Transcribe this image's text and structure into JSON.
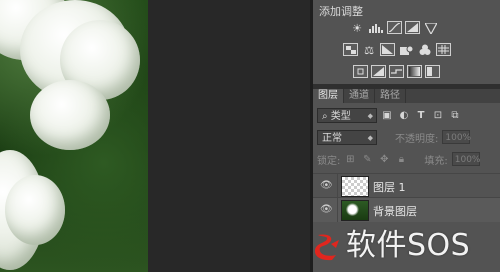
{
  "adjustments": {
    "title": "添加调整",
    "row1_icons": [
      "brightness-sun-icon",
      "levels-icon",
      "curves-icon",
      "exposure-icon",
      "vibrance-triangle-icon"
    ],
    "row2_icons": [
      "hue-saturation-icon",
      "color-balance-icon",
      "black-white-icon",
      "photo-filter-icon",
      "channel-mixer-icon",
      "color-lookup-icon"
    ],
    "row3_icons": [
      "invert-icon",
      "posterize-icon",
      "threshold-icon",
      "gradient-map-icon",
      "selective-color-icon"
    ]
  },
  "layers_panel": {
    "tabs": [
      "图层",
      "通道",
      "路径"
    ],
    "active_tab": 0,
    "filter": {
      "search_glyph": "⌕",
      "kind_label": "类型"
    },
    "blend_mode": "正常",
    "opacity_label": "不透明度:",
    "opacity_value": "100%",
    "lock_label": "锁定:",
    "fill_label": "填充:",
    "fill_value": "100%",
    "layers": [
      {
        "name": "图层 1",
        "thumbnail": "transparent",
        "visible": true
      },
      {
        "name": "背景图层",
        "thumbnail": "photo",
        "visible": true
      }
    ]
  },
  "watermark": {
    "text": "软件SOS"
  },
  "colors": {
    "panel_bg": "#535353",
    "canvas_bg": "#282828",
    "watermark_red": "#e0261e"
  }
}
